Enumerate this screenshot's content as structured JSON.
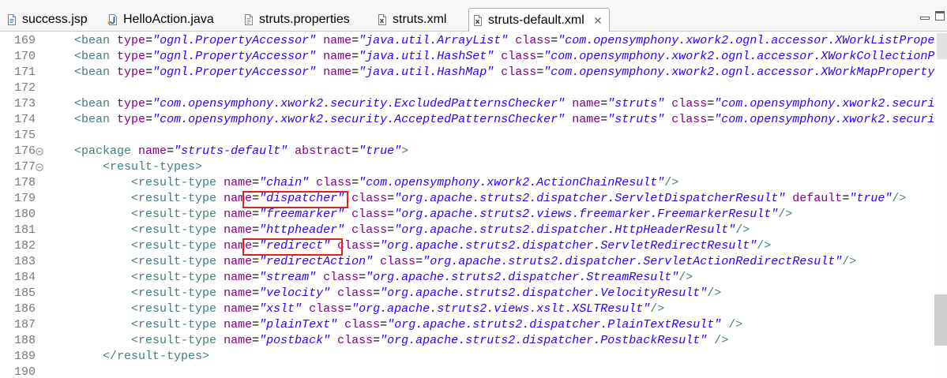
{
  "editor_tabs": [
    {
      "label": "success.jsp",
      "icon": "jsp-file-icon",
      "active": false
    },
    {
      "label": "HelloAction.java",
      "icon": "java-file-icon",
      "active": false
    },
    {
      "label": "struts.properties",
      "icon": "properties-file-icon",
      "active": false
    },
    {
      "label": "struts.xml",
      "icon": "xml-file-icon",
      "active": false
    },
    {
      "label": "struts-default.xml",
      "icon": "xml-file-icon",
      "active": true,
      "close_icon": "close-icon"
    }
  ],
  "window_controls": {
    "minimize": "minimize-icon",
    "maximize": "maximize-icon"
  },
  "editor": {
    "lines": [
      {
        "number": "169",
        "text": "    <bean type=\"ognl.PropertyAccessor\" name=\"java.util.ArrayList\" class=\"com.opensymphony.xwork2.ognl.accessor.XWorkListPrope"
      },
      {
        "number": "170",
        "text": "    <bean type=\"ognl.PropertyAccessor\" name=\"java.util.HashSet\" class=\"com.opensymphony.xwork2.ognl.accessor.XWorkCollectionP"
      },
      {
        "number": "171",
        "text": "    <bean type=\"ognl.PropertyAccessor\" name=\"java.util.HashMap\" class=\"com.opensymphony.xwork2.ognl.accessor.XWorkMapProperty"
      },
      {
        "number": "172",
        "text": ""
      },
      {
        "number": "173",
        "text": "    <bean type=\"com.opensymphony.xwork2.security.ExcludedPatternsChecker\" name=\"struts\" class=\"com.opensymphony.xwork2.securi"
      },
      {
        "number": "174",
        "text": "    <bean type=\"com.opensymphony.xwork2.security.AcceptedPatternsChecker\" name=\"struts\" class=\"com.opensymphony.xwork2.securi"
      },
      {
        "number": "175",
        "text": ""
      },
      {
        "number": "176",
        "text": "    <package name=\"struts-default\" abstract=\"true\">",
        "foldable": true
      },
      {
        "number": "177",
        "text": "        <result-types>",
        "foldable": true
      },
      {
        "number": "178",
        "text": "            <result-type name=\"chain\" class=\"com.opensymphony.xwork2.ActionChainResult\"/>"
      },
      {
        "number": "179",
        "text": "            <result-type name=\"dispatcher\" class=\"org.apache.struts2.dispatcher.ServletDispatcherResult\" default=\"true\"/>"
      },
      {
        "number": "180",
        "text": "            <result-type name=\"freemarker\" class=\"org.apache.struts2.views.freemarker.FreemarkerResult\"/>"
      },
      {
        "number": "181",
        "text": "            <result-type name=\"httpheader\" class=\"org.apache.struts2.dispatcher.HttpHeaderResult\"/>"
      },
      {
        "number": "182",
        "text": "            <result-type name=\"redirect\" class=\"org.apache.struts2.dispatcher.ServletRedirectResult\"/>"
      },
      {
        "number": "183",
        "text": "            <result-type name=\"redirectAction\" class=\"org.apache.struts2.dispatcher.ServletActionRedirectResult\"/>"
      },
      {
        "number": "184",
        "text": "            <result-type name=\"stream\" class=\"org.apache.struts2.dispatcher.StreamResult\"/>"
      },
      {
        "number": "185",
        "text": "            <result-type name=\"velocity\" class=\"org.apache.struts2.dispatcher.VelocityResult\"/>"
      },
      {
        "number": "186",
        "text": "            <result-type name=\"xslt\" class=\"org.apache.struts2.views.xslt.XSLTResult\"/>"
      },
      {
        "number": "187",
        "text": "            <result-type name=\"plainText\" class=\"org.apache.struts2.dispatcher.PlainTextResult\" />"
      },
      {
        "number": "188",
        "text": "            <result-type name=\"postback\" class=\"org.apache.struts2.dispatcher.PostbackResult\" />"
      },
      {
        "number": "189",
        "text": "        </result-types>"
      },
      {
        "number": "190",
        "text": ""
      }
    ],
    "vertical_scroll": {
      "position": 0.89,
      "visible_portion": 0.148
    }
  },
  "highlight_boxes": [
    {
      "line": 179
    },
    {
      "line": 182
    }
  ],
  "colors": {
    "tag": "#3f7f7f",
    "attribute_name": "#7f007f",
    "attribute_value": "#2a00ff",
    "equals": "#000000",
    "line_number": "#787878",
    "highlight_box": "#e3201b"
  }
}
